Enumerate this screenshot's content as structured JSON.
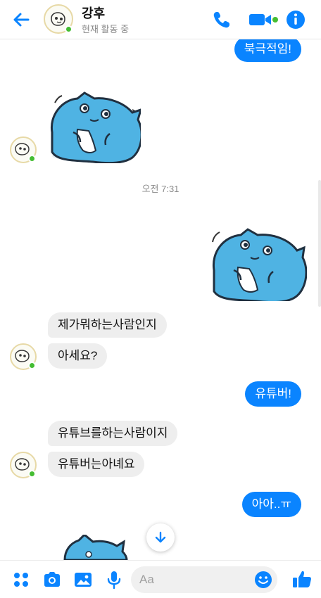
{
  "header": {
    "name": "강후",
    "status": "현재 활동 중",
    "icons": [
      "back-arrow-icon",
      "phone-icon",
      "video-call-icon",
      "info-icon"
    ]
  },
  "colors": {
    "accent": "#0a84ff",
    "incoming_bubble": "#eeeeee",
    "online_dot": "#44bd32",
    "sticker_blue": "#4fb3e3"
  },
  "messages": {
    "m1": "북극적임!",
    "timestamp": "오전 7:31",
    "m2": "제가뭐하는사람인지",
    "m3": "아세요?",
    "m4": "유튜버!",
    "m5": "유튜브를하는사람이지",
    "m6": "유튜버는아녜요",
    "m7": "아아..ㅠ"
  },
  "composer": {
    "placeholder": "Aa"
  },
  "bottombar": {
    "icons": [
      "apps-icon",
      "camera-icon",
      "gallery-icon",
      "microphone-icon",
      "emoji-icon",
      "thumbs-up-icon"
    ]
  }
}
